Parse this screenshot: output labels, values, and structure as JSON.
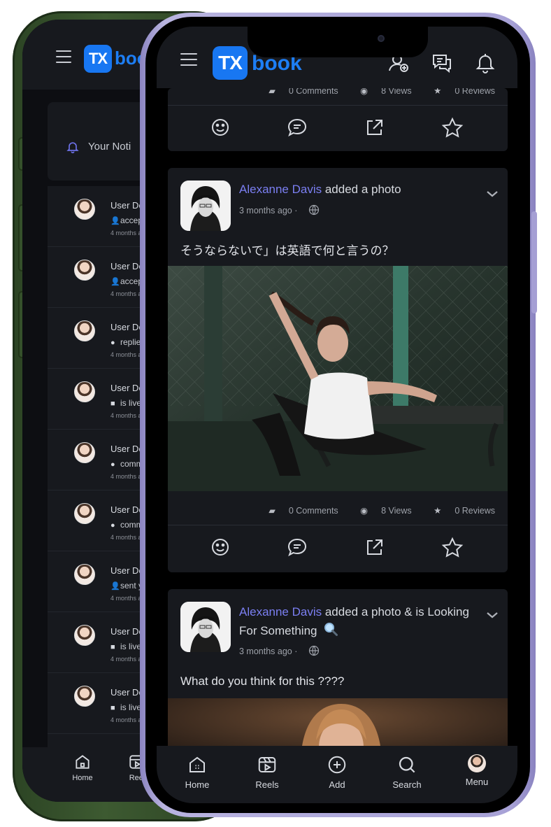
{
  "brand": {
    "logo_mark": "TX",
    "logo_word": "book",
    "accent": "#1877f2"
  },
  "back_phone": {
    "notifications_title": "Your Noti",
    "items": [
      {
        "name": "User Dem",
        "icon": "user-plus-icon",
        "action": "accep",
        "time": "4 months ag"
      },
      {
        "name": "User Dem",
        "icon": "user-plus-icon",
        "action": "accep",
        "time": "4 months ag"
      },
      {
        "name": "User Dem",
        "icon": "comment-icon",
        "action": "replie",
        "time": "4 months ag"
      },
      {
        "name": "User Dem",
        "icon": "video-icon",
        "action": "is live",
        "time": "4 months ag"
      },
      {
        "name": "User Dem",
        "icon": "comment-icon",
        "action": "comm",
        "time": "4 months ag"
      },
      {
        "name": "User Dem",
        "icon": "comment-icon",
        "action": "comm",
        "time": "4 months ag"
      },
      {
        "name": "User Dem",
        "icon": "user-plus-icon",
        "action": "sent y",
        "time": "4 months ag"
      },
      {
        "name": "User Dem",
        "icon": "video-icon",
        "action": "is live",
        "time": "4 months ag"
      },
      {
        "name": "User Dem",
        "icon": "video-icon",
        "action": "is live",
        "time": "4 months ag"
      }
    ],
    "nav": [
      {
        "label": "Home"
      },
      {
        "label": "Reel"
      }
    ]
  },
  "feed": {
    "top_card": {
      "comments": "0 Comments",
      "views": "8 Views",
      "reviews": "0 Reviews"
    },
    "posts": [
      {
        "author": "Alexanne Davis",
        "action": " added a photo",
        "time": "3 months ago ·",
        "text": "そうならないで」は英語で何と言うの？",
        "comments": "0 Comments",
        "views": "8 Views",
        "reviews": "0 Reviews"
      },
      {
        "author": "Alexanne Davis",
        "action": " added a photo & is Looking For Something",
        "time": "3 months ago ·",
        "text": "What do you think for this ????"
      }
    ]
  },
  "bottom_nav": [
    {
      "label": "Home",
      "icon": "home-icon"
    },
    {
      "label": "Reels",
      "icon": "reels-icon"
    },
    {
      "label": "Add",
      "icon": "add-icon"
    },
    {
      "label": "Search",
      "icon": "search-icon"
    },
    {
      "label": "Menu",
      "icon": "profile-avatar"
    }
  ]
}
